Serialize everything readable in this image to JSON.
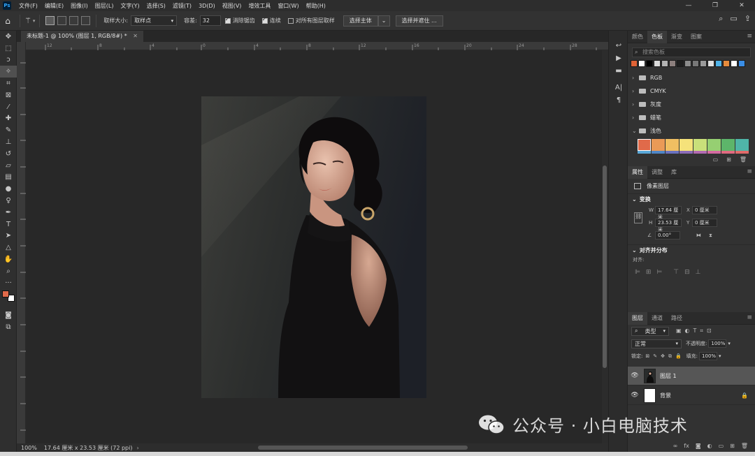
{
  "app": {
    "logo": "Ps"
  },
  "menu": [
    "文件(F)",
    "编辑(E)",
    "图像(I)",
    "图层(L)",
    "文字(Y)",
    "选择(S)",
    "滤镜(T)",
    "3D(D)",
    "视图(V)",
    "增效工具",
    "窗口(W)",
    "帮助(H)"
  ],
  "window_controls": {
    "minimize": "—",
    "restore": "❐",
    "close": "✕"
  },
  "options": {
    "sample_size_label": "取样大小:",
    "sample_size_value": "取样点",
    "tolerance_label": "容差:",
    "tolerance_value": "32",
    "antialias_label": "消除锯齿",
    "antialias_checked": true,
    "contiguous_label": "连续",
    "contiguous_checked": true,
    "all_layers_label": "对所有图层取样",
    "all_layers_checked": false,
    "select_subject_label": "选择主体",
    "select_and_mask_label": "选择并遮住 ..."
  },
  "document": {
    "tab_title": "未标题-1 @ 100% (图层 1, RGB/8#) *",
    "tab_close": "✕"
  },
  "ruler": {
    "h_ticks": [
      "12",
      "10",
      "8",
      "6",
      "4",
      "2",
      "0",
      "2",
      "4",
      "6",
      "8",
      "10",
      "12",
      "14",
      "16",
      "18",
      "20",
      "22",
      "24",
      "26",
      "28",
      "30"
    ],
    "v_ticks": [
      "2",
      "0",
      "2",
      "4",
      "6",
      "8",
      "10",
      "12",
      "14",
      "16",
      "18",
      "20",
      "22",
      "24",
      "26"
    ]
  },
  "status": {
    "zoom": "100%",
    "doc_info": "17.64 厘米 x 23.53 厘米 (72 ppi)",
    "arrow": "›"
  },
  "panels": {
    "top_tabs": [
      "颜色",
      "色板",
      "渐变",
      "图案"
    ],
    "top_active": "色板",
    "swatch_search_placeholder": "搜索色板",
    "recent_swatches": [
      "#e06336",
      "#ffffff",
      "#000000",
      "#d9d9d9",
      "#b3b3b3",
      "#8c7f7d",
      "#1f1f1f",
      "#8c8c8c",
      "#777777",
      "#9a9a9a",
      "#e0e0e0",
      "#4fb3e8",
      "#e58b3c",
      "#ffffff",
      "#3a8ee6"
    ],
    "swatch_groups": [
      "RGB",
      "CMYK",
      "灰度",
      "蜡笔",
      "浅色"
    ],
    "pastel_swatches": [
      "#e06a4a",
      "#ea9a57",
      "#f0bf62",
      "#f5e27a",
      "#c9e07a",
      "#96cf72",
      "#5db56a",
      "#4fb5a8"
    ],
    "pastel_swatches_row2": [
      "#5aa8d8",
      "#4f86c6",
      "#6a72c0",
      "#8c6cb8",
      "#b26ab2",
      "#d46aa0",
      "#e06a80",
      "#e06a6a"
    ],
    "prop_tabs": [
      "属性",
      "调整",
      "库"
    ],
    "prop_active": "属性",
    "pixel_layer_label": "像素图层",
    "transform_title": "变换",
    "w_label": "W",
    "w_value": "17.64 厘米",
    "h_label": "H",
    "h_value": "23.53 厘米",
    "x_label": "X",
    "x_value": "0 厘米",
    "y_label": "Y",
    "y_value": "0 厘米",
    "angle_value": "0.00°",
    "align_title": "对齐并分布",
    "align_label": "对齐:",
    "layers_tabs": [
      "图层",
      "通道",
      "路径"
    ],
    "layers_active": "图层",
    "filter_label": "类型",
    "blend_mode": "正常",
    "opacity_label": "不透明度:",
    "opacity_value": "100%",
    "lock_label": "锁定:",
    "fill_label": "填充:",
    "fill_value": "100%",
    "layers": [
      {
        "name": "图层 1",
        "selected": true
      },
      {
        "name": "背景",
        "selected": false
      }
    ]
  },
  "watermark": {
    "text": "公众号 · 小白电脑技术"
  },
  "colors": {
    "foreground": "#e06a4a",
    "background": "#ffffff",
    "accent": "#31a8ff"
  }
}
